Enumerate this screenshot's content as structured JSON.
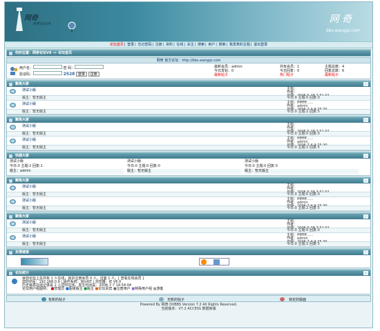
{
  "header": {
    "logo_text": "网奇",
    "sub_title": "免费论坛V8",
    "brand": "网 奇",
    "url": "bbs.wangqi.com"
  },
  "nav": [
    "论坛首页",
    "登录",
    "忘记密码",
    "注册",
    "资料",
    "在线",
    "关注",
    "搜索",
    "用户",
    "搜索",
    "我发表的主题",
    "退出登录"
  ],
  "breadcrumb": "你的位置：网奇论坛V8 -> 论坛首页",
  "notice_title": "网奇 官方论坛：http://bbs.wangqi.com",
  "login": {
    "user_label": "用户名：",
    "pass_label": "密 码：",
    "code_label": "验证码：",
    "code": "2528",
    "login_btn": "登录",
    "reg_btn": "注册"
  },
  "stats": {
    "members": "最新会员：admin",
    "total_members": "共有会员：1",
    "topics": "主题总数：4",
    "today_posts": "今日发帖：0",
    "today_new": "今日回复：0",
    "replies": "回复总数：6",
    "hot_posts": "最新帖子",
    "hot_label": "热门帖子",
    "newest": "最新帖子"
  },
  "sections": [
    {
      "title": "聚焦大家",
      "forums": [
        {
          "name": "测试小版",
          "desc": "",
          "mod": "版主：暂无版主",
          "stat": "今日:0  主题:0  回复:0",
          "last": [
            "主题：",
            "作者：",
            "日期：2006-5-28 3:51:02"
          ]
        },
        {
          "name": "测试小版",
          "desc": "",
          "mod": "版主：暂无版主",
          "stat": "今日:0  主题:2  回复:5",
          "last": [
            "主题：ffffffff......",
            "作者：admin",
            "日期：2006-7-4 9:25:30"
          ]
        }
      ]
    },
    {
      "title": "聚焦大家",
      "forums": [
        {
          "name": "测试小版",
          "desc": "",
          "mod": "版主：暂无版主",
          "stat": "今日:0  主题:0  回复:0",
          "last": [
            "主题：",
            "作者：",
            "日期：2006-5-28 3:51:02"
          ]
        },
        {
          "name": "测试小版",
          "desc": "",
          "mod": "版主：暂无版主",
          "stat": "今日:0  主题:2  回复:5",
          "last": [
            "主题：ffffffff......",
            "作者：admin",
            "日期：2006-7-4 9:25:30"
          ]
        }
      ]
    },
    {
      "title": "聚焦大家",
      "forums": [
        {
          "name": "测试小版",
          "desc": "",
          "mod": "版主：暂无版主",
          "stat": "今日:0  主题:0  回复:0",
          "last": [
            "主题：",
            "作者：",
            "日期：2006-5-28 3:51:02"
          ]
        },
        {
          "name": "测试小版",
          "desc": "",
          "mod": "版主：暂无版主",
          "stat": "今日:0  主题:2  回复:5",
          "last": [
            "主题：ffffffff......",
            "作者：admin",
            "日期：2006-7-4 9:25:30"
          ]
        }
      ]
    },
    {
      "title": "聚焦大家",
      "forums": [
        {
          "name": "测试小版",
          "desc": "",
          "mod": "版主：暂无版主",
          "stat": "今日:0  主题:0  回复:0",
          "last": [
            "主题：",
            "作者：",
            "日期：2006-5-28 3:51:02"
          ]
        },
        {
          "name": "测试小版",
          "desc": "",
          "mod": "版主：暂无版主",
          "stat": "今日:0  主题:2  回复:5",
          "last": [
            "主题：ffffffff......",
            "作者：admin",
            "日期：2006-7-4 9:25:30"
          ]
        }
      ]
    }
  ],
  "three_col": {
    "title": "快捷大家",
    "cols": [
      {
        "name": "测试小版",
        "stat": "今日:0 主题:2 回复:1",
        "mod": "版主：admin"
      },
      {
        "name": "测试小版",
        "stat": "今日:0 主题:0 回复:0",
        "mod": "版主：暂无版主"
      },
      {
        "name": "测试小版",
        "stat": "今日:0 主题:0 回复:0",
        "mod": "版主：暂无版主"
      }
    ]
  },
  "links_title": "友情链接",
  "online_title": "论坛统计",
  "online": [
    "目前论坛上总共有 1 人在线，其中注册会员 0 人，访客 1 人。[ 查看在线会员 ]",
    "您的IP是：192.168.0.9 | 操作系统：WinNT | 浏览器：IE V6.0",
    "历史最高在线记录是 2 人同时在线，发生时间是：2006-7-7 14:54:04"
  ],
  "legend": [
    "论坛用户组图例：",
    "管理员",
    "超级版主",
    "版主",
    "论坛贵宾",
    "注册用户",
    "特殊用户组",
    "游客"
  ],
  "bottom": [
    "有新的帖子",
    "无新的帖子",
    "锁定的版面"
  ],
  "footer": {
    "line1": "Powered By 网奇 DVBBS Version 7.2 All Rights Reserved.",
    "line2": "当前版本：V7.2 ACCESS 数据库版"
  }
}
